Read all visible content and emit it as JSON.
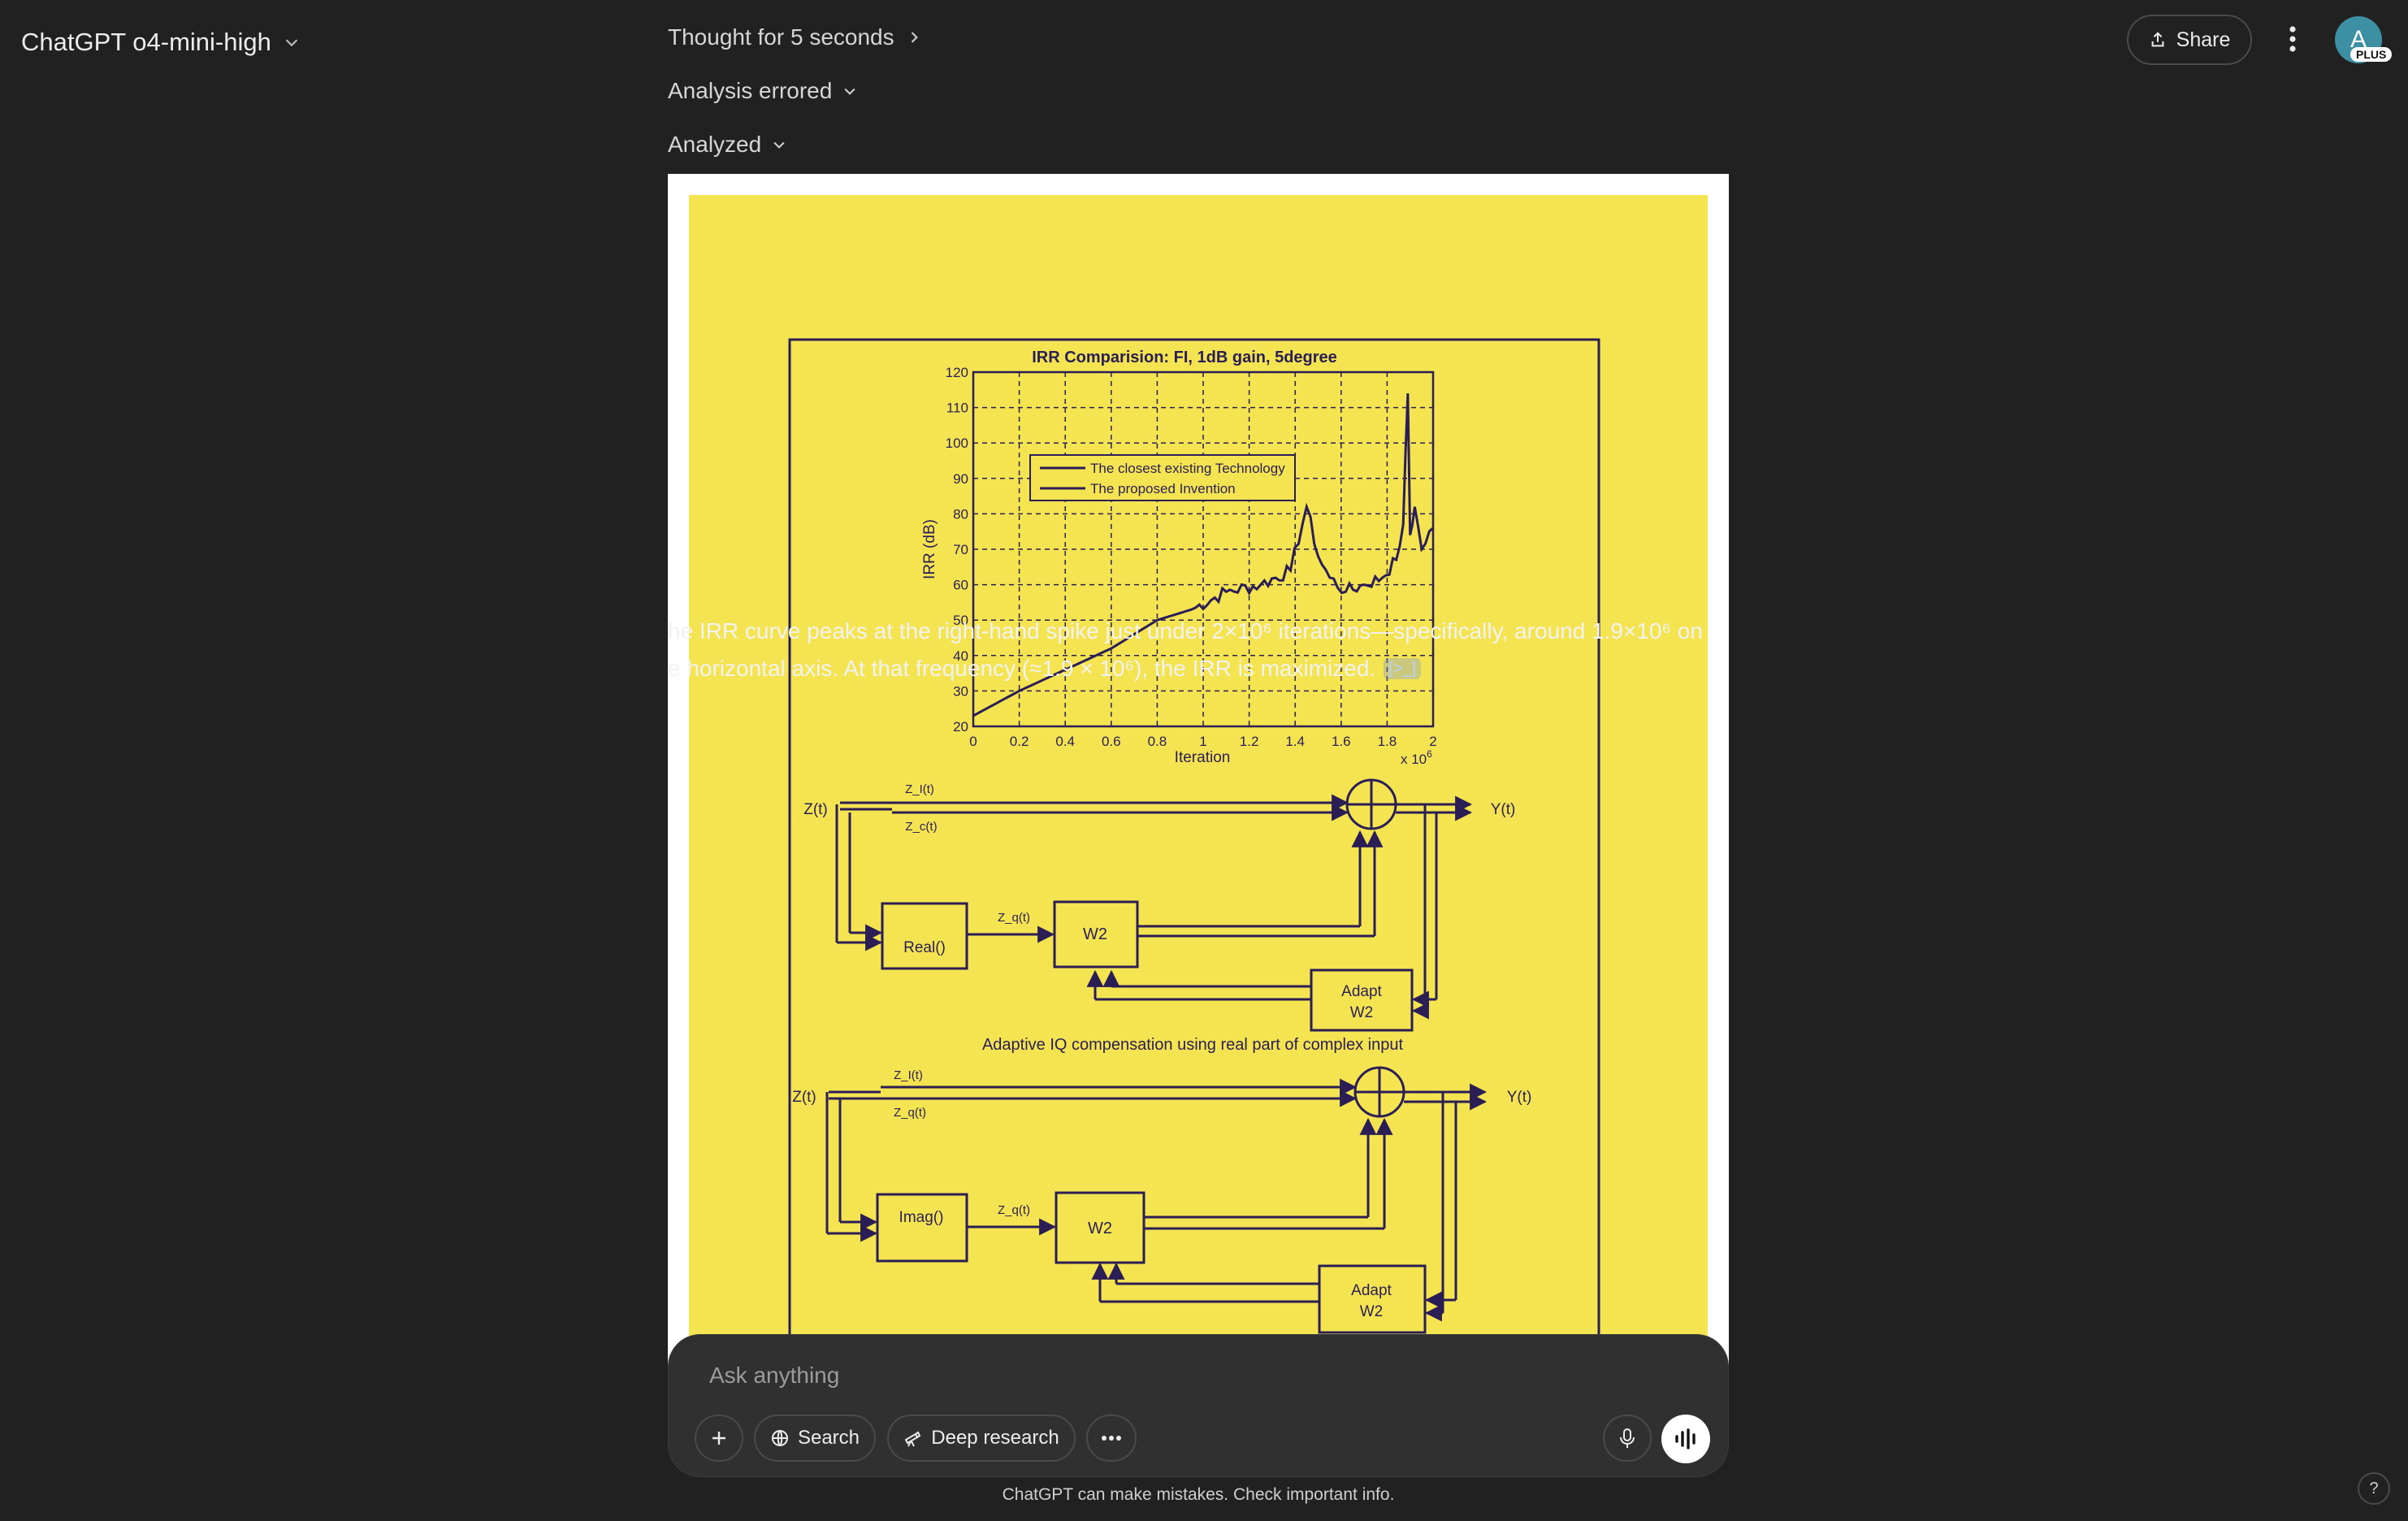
{
  "header": {
    "model_name": "ChatGPT o4-mini-high",
    "share_label": "Share",
    "avatar_letter": "A",
    "avatar_badge": "PLUS"
  },
  "reasoning": {
    "thought_label": "Thought for 5 seconds",
    "analysis_errored_label": "Analysis errored",
    "analyzed_label": "Analyzed"
  },
  "figure": {
    "title": "IRR Comparision: FI, 1dB gain, 5degree",
    "ylabel": "IRR (dB)",
    "xlabel": "Iteration",
    "x_multiplier": "x 10",
    "x_multiplier_exp": "6",
    "legend": [
      "The closest existing Technology",
      "The proposed Invention"
    ],
    "y_ticks": [
      "120",
      "110",
      "100",
      "90",
      "80",
      "70",
      "60",
      "50",
      "40",
      "30",
      "20"
    ],
    "x_ticks": [
      "0",
      "0.2",
      "0.4",
      "0.6",
      "0.8",
      "1",
      "1.2",
      "1.4",
      "1.6",
      "1.8",
      "2"
    ],
    "diagram1": {
      "input": "Z(t)",
      "upper": "Z_I(t)",
      "lower": "Z_c(t)",
      "mid": "Z_q(t)",
      "block_real": "Real()",
      "block_w2": "W2",
      "block_adapt": "Adapt",
      "block_adapt2": "W2",
      "output": "Y(t)",
      "caption": "Adaptive IQ compensation using real part of complex input"
    },
    "diagram2": {
      "input": "Z(t)",
      "upper": "Z_I(t)",
      "lower": "Z_q(t)",
      "mid": "Z_q(t)",
      "block_imag": "Imag()",
      "block_w2": "W2",
      "block_adapt": "Adapt",
      "block_adapt2": "W2",
      "output": "Y(t)"
    }
  },
  "chart_data": {
    "type": "line",
    "title": "IRR Comparision: FI, 1dB gain, 5degree",
    "xlabel": "Iteration",
    "ylabel": "IRR (dB)",
    "x_scale_note": "x 10^6",
    "xlim": [
      0,
      2
    ],
    "ylim": [
      20,
      120
    ],
    "grid": true,
    "legend_position": "top-left",
    "series": [
      {
        "name": "The proposed Invention",
        "x": [
          0,
          0.2,
          0.4,
          0.6,
          0.8,
          0.95,
          1.1,
          1.25,
          1.38,
          1.45,
          1.5,
          1.55,
          1.62,
          1.7,
          1.78,
          1.84,
          1.87,
          1.89,
          1.9,
          1.92,
          1.95,
          2.0
        ],
        "y": [
          23,
          30,
          36,
          42,
          50,
          53,
          58,
          60,
          64,
          82,
          68,
          62,
          58,
          60,
          62,
          67,
          77,
          114,
          74,
          82,
          70,
          76
        ]
      }
    ]
  },
  "answer": {
    "line1": "he IRR curve peaks at the right-hand spike just under 2×10⁶ iterations—specifically, around 1.9×10⁶ on",
    "line2": "e horizontal axis. At that frequency (≈1.9 × 10⁶), the IRR is maximized.",
    "citation": "[>_]"
  },
  "composer": {
    "placeholder": "Ask anything",
    "search_label": "Search",
    "deep_research_label": "Deep research"
  },
  "footer": {
    "disclaimer": "ChatGPT can make mistakes. Check important info.",
    "help": "?"
  }
}
